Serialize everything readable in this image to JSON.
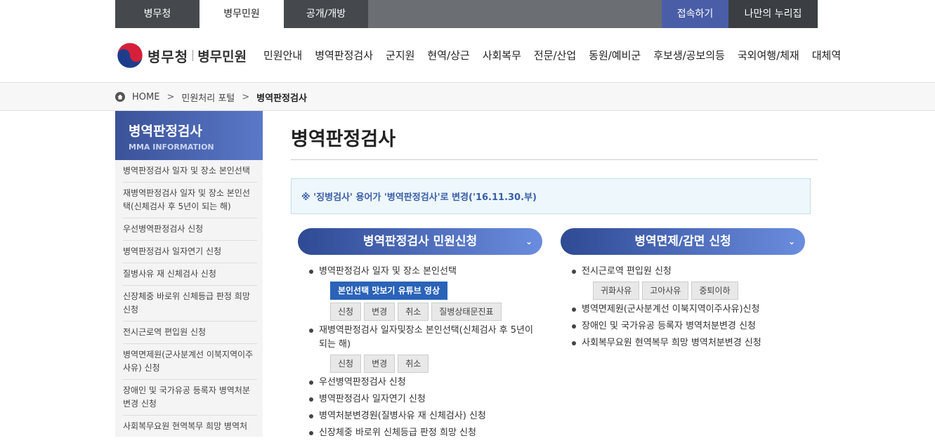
{
  "topbar": {
    "tabs": [
      "병무청",
      "병무민원",
      "공개/개방"
    ],
    "right": [
      "접속하기",
      "나만의 누리집"
    ]
  },
  "header": {
    "logo_name": "병무청",
    "logo_sub": "병무민원",
    "gnb": [
      "민원안내",
      "병역판정검사",
      "군지원",
      "현역/상근",
      "사회복무",
      "전문/산업",
      "동원/예비군",
      "후보생/공보의등",
      "국외여행/체재",
      "대체역"
    ]
  },
  "breadcrumb": {
    "home": "HOME",
    "items": [
      "민원처리 포털",
      "병역판정검사"
    ]
  },
  "lnb": {
    "title": "병역판정검사",
    "subtitle": "MMA INFORMATION",
    "items": [
      "병역판정검사 일자 및 장소 본인선택",
      "재병역판정검사 일자 및 장소 본인선택(신체검사 후 5년이 되는 해)",
      "우선병역판정검사 신청",
      "병역판정검사 일자연기 신청",
      "질병사유 재 신체검사 신청",
      "신장체중 바로위 신체등급 판정 희망 신청",
      "전시근로역 편입원 신청",
      "병역면제원(군사분계선 이북지역이주사유) 신청",
      "장애인 및 국가유공 등록자 병역처분변경 신청",
      "사회복무요원 현역복무 희망 병역처"
    ]
  },
  "main": {
    "title": "병역판정검사",
    "notice": "※ '징병검사' 용어가 '병역판정검사'로 변경('16.11.30.부)",
    "left": {
      "header": "병역판정검사 민원신청",
      "item1": "병역판정검사 일자 및 장소 본인선택",
      "youtube_btn": "본인선택 맛보기 유튜브 영상",
      "btns1": [
        "신청",
        "변경",
        "취소",
        "질병상태문진표"
      ],
      "item2": "재병역판정검사 일자및장소 본인선택(신체검사 후 5년이 되는 해)",
      "btns2": [
        "신청",
        "변경",
        "취소"
      ],
      "items_rest": [
        "우선병역판정검사 신청",
        "병역판정검사 일자연기 신청",
        "병역처분변경원(질병사유 재 신체검사) 신청",
        "신장체중 바로위 신체등급 판정 희망 신청"
      ]
    },
    "right": {
      "header": "병역면제/감면 신청",
      "item1": "전시근로역 편입원 신청",
      "btns1": [
        "귀화사유",
        "고아사유",
        "중퇴이하"
      ],
      "items_rest": [
        "병역면제원(군사분계선 이북지역이주사유)신청",
        "장애인 및 국가유공 등록자 병역처분변경 신청",
        "사회복무요원 현역복무 희망 병역처분변경 신청"
      ]
    }
  }
}
